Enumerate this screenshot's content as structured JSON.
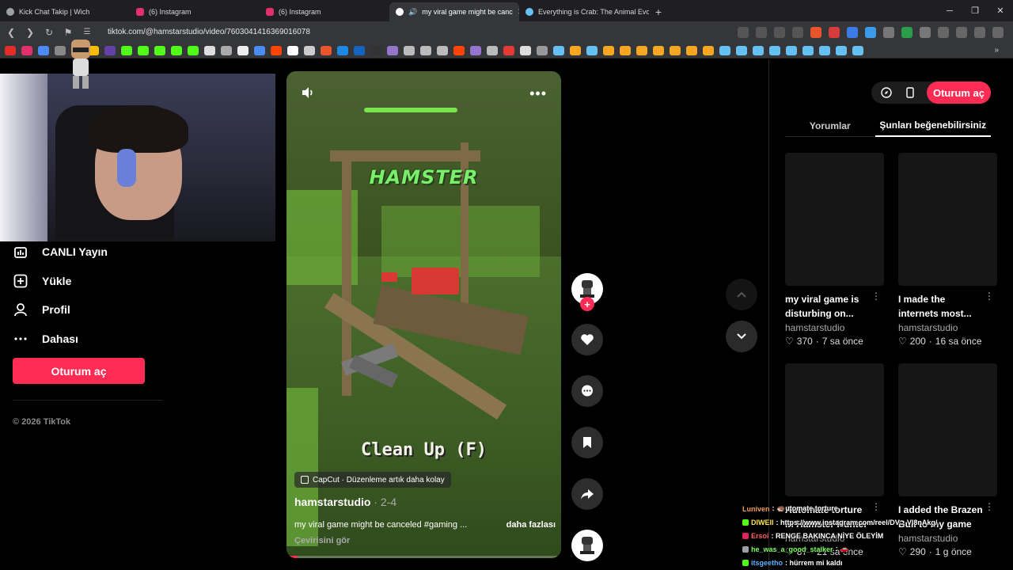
{
  "browser": {
    "tabs": [
      {
        "label": "Kick Chat Takip | Wich",
        "icon": "globe-icon",
        "color": "#9aa0a6"
      },
      {
        "label": "(6) Instagram",
        "icon": "instagram-icon",
        "color": "#e1306c"
      },
      {
        "label": "(6) Instagram",
        "icon": "instagram-icon",
        "color": "#e1306c"
      },
      {
        "label": "my viral game might be canc",
        "icon": "tiktok-icon",
        "color": "#ffffff",
        "active": true
      },
      {
        "label": "Everything is Crab: The Animal Evolu",
        "icon": "steam-icon",
        "color": "#66c0f4"
      }
    ],
    "new_tab": "+",
    "url": "tiktok.com/@hamstarstudio/video/7603041416369016078"
  },
  "sidebar": {
    "items": [
      {
        "label": "CANLI Yayın",
        "icon": "live-icon"
      },
      {
        "label": "Yükle",
        "icon": "upload-icon"
      },
      {
        "label": "Profil",
        "icon": "profile-icon"
      },
      {
        "label": "Dahası",
        "icon": "more-icon"
      }
    ],
    "login": "Oturum aç",
    "copyright": "© 2026 TikTok"
  },
  "video": {
    "overlay_title": "HAMSTER",
    "overlay_hint": "Clean Up (F)",
    "capcut": "CapCut · Düzenleme artık daha kolay",
    "author": "hamstarstudio",
    "date": " · 2-4",
    "caption": "my viral game might be canceled #gaming ...",
    "more": "daha fazlası",
    "translate": "Çevirisini gör",
    "progress": 0.04
  },
  "right_panel": {
    "login": "Oturum aç",
    "tabs": [
      "Yorumlar",
      "Şunları beğenebilirsiniz"
    ],
    "cards": [
      {
        "title": "my viral game is disturbing on...",
        "author": "hamstarstudio",
        "likes": "370",
        "age": "7 sa önce"
      },
      {
        "title": "I made the internets most...",
        "author": "hamstarstudio",
        "likes": "200",
        "age": "16 sa önce"
      },
      {
        "title": "Automate torture in Hamster Hunter",
        "author": "hamstarstudio",
        "likes": "87",
        "age": "21 sa önce"
      },
      {
        "title": "I added the Brazen Bull to my game",
        "author": "hamstarstudio",
        "likes": "290",
        "age": "1 g önce"
      }
    ]
  },
  "chat": [
    {
      "user": "Luniven",
      "color": "#f09a5a",
      "msg": ": 🦔utomate torture",
      "badge": ""
    },
    {
      "user": "DIWEII",
      "color": "#ffe44d",
      "msg": ": https://www.instagram.com/reel/DV... Vl8nAkg/",
      "badge": "#53fc18"
    },
    {
      "user": "Ersoi",
      "color": "#ff6060",
      "msg": ": RENGE BAKINCA NİYE ÖLEYİM",
      "badge": "#e0245e"
    },
    {
      "user": "he_was_a_good_stalker",
      "color": "#7bff5a",
      "msg": ": 🚗",
      "badge": "#9aa0a6"
    },
    {
      "user": "itsgeetho",
      "color": "#5ab0ff",
      "msg": ": hürrem mi kaldı",
      "badge": "#53fc18"
    }
  ]
}
